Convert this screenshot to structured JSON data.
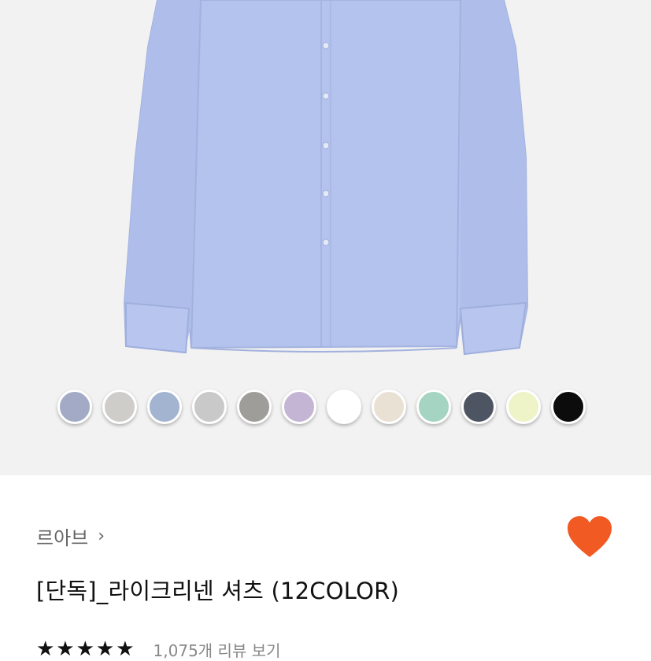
{
  "product": {
    "swatches": [
      {
        "color": "#a3aac6"
      },
      {
        "color": "#cfcdca"
      },
      {
        "color": "#a3b4d0"
      },
      {
        "color": "#c9c9c9"
      },
      {
        "color": "#9e9d99"
      },
      {
        "color": "#c5b5d4"
      },
      {
        "color": "#ffffff"
      },
      {
        "color": "#e9e1d4"
      },
      {
        "color": "#a5d4c3"
      },
      {
        "color": "#4e5562"
      },
      {
        "color": "#eef3c8"
      },
      {
        "color": "#0c0c0c"
      }
    ],
    "brand": "르아브",
    "brand_chevron": "›",
    "title": "[단독]_라이크리넨 셔츠 (12COLOR)",
    "stars": "★★★★★",
    "review_text": "1,075개 리뷰 보기",
    "wishlist_icon": "heart-icon",
    "accent_color": "#f25a24",
    "shirt_color": "#b3c3ef"
  }
}
